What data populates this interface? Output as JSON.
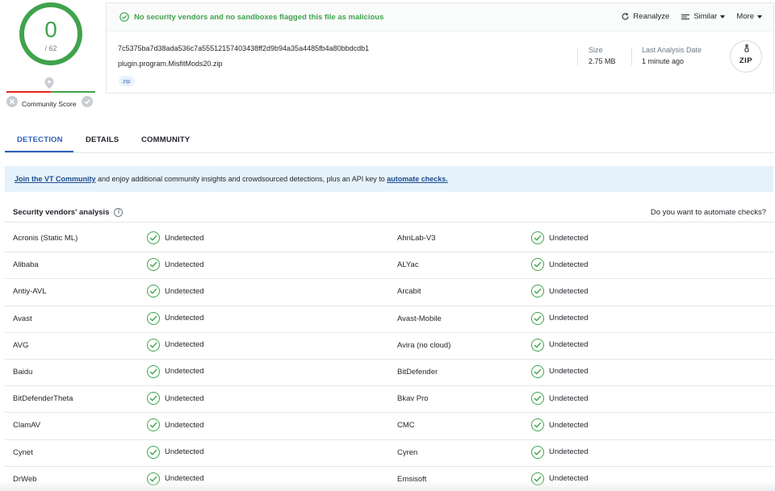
{
  "score": {
    "detections": "0",
    "total": "/ 62",
    "community_label": "Community Score"
  },
  "verdict": "No security vendors and no sandboxes flagged this file as malicious",
  "actions": [
    {
      "label": "Reanalyze",
      "icon": "refresh-icon"
    },
    {
      "label": "Similar",
      "icon": "similar-icon"
    },
    {
      "label": "More",
      "icon": ""
    }
  ],
  "file": {
    "hash": "7c5375ba7d38ada536c7a55512157403438ff2d9b94a35a4485fb4a80bbdcdb1",
    "name": "plugin.program.MisfitMods20.zip",
    "tag": "zip",
    "size_label": "Size",
    "size": "2.75 MB",
    "date_label": "Last Analysis Date",
    "date": "1 minute ago",
    "type_badge": "ZIP"
  },
  "tabs": [
    "DETECTION",
    "DETAILS",
    "COMMUNITY"
  ],
  "banner": {
    "link1": "Join the VT Community",
    "mid": " and enjoy additional community insights and crowdsourced detections, plus an API key to ",
    "link2": "automate checks."
  },
  "section": {
    "title": "Security vendors' analysis",
    "right": "Do you want to automate checks?"
  },
  "rows": [
    [
      "Acronis (Static ML)",
      "Undetected",
      "AhnLab-V3",
      "Undetected"
    ],
    [
      "Alibaba",
      "Undetected",
      "ALYac",
      "Undetected"
    ],
    [
      "Antiy-AVL",
      "Undetected",
      "Arcabit",
      "Undetected"
    ],
    [
      "Avast",
      "Undetected",
      "Avast-Mobile",
      "Undetected"
    ],
    [
      "AVG",
      "Undetected",
      "Avira (no cloud)",
      "Undetected"
    ],
    [
      "Baidu",
      "Undetected",
      "BitDefender",
      "Undetected"
    ],
    [
      "BitDefenderTheta",
      "Undetected",
      "Bkav Pro",
      "Undetected"
    ],
    [
      "ClamAV",
      "Undetected",
      "CMC",
      "Undetected"
    ],
    [
      "Cynet",
      "Undetected",
      "Cyren",
      "Undetected"
    ],
    [
      "DrWeb",
      "Undetected",
      "Emsisoft",
      "Undetected"
    ]
  ],
  "colors": {
    "clean": "#3fa34d",
    "accent": "#2b5fb8",
    "malicious": "#e1251b"
  }
}
